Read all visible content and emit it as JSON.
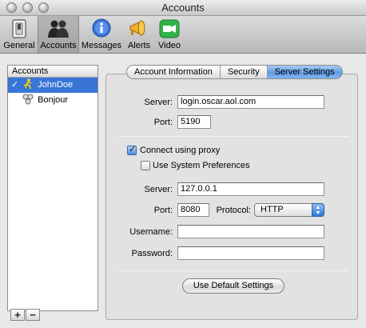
{
  "window": {
    "title": "Accounts"
  },
  "toolbar": {
    "items": [
      {
        "label": "General",
        "icon": "switch-icon"
      },
      {
        "label": "Accounts",
        "icon": "people-icon"
      },
      {
        "label": "Messages",
        "icon": "info-bubble-icon"
      },
      {
        "label": "Alerts",
        "icon": "megaphone-icon"
      },
      {
        "label": "Video",
        "icon": "camera-icon"
      }
    ],
    "selected": "Accounts"
  },
  "accounts": {
    "header": "Accounts",
    "items": [
      {
        "check": "✓",
        "name": "JohnDoe",
        "icon": "aim-running-man-icon",
        "selected": true
      },
      {
        "check": "",
        "name": "Bonjour",
        "icon": "bonjour-icon",
        "selected": false
      }
    ],
    "add_label": "+",
    "remove_label": "−"
  },
  "tabs": [
    {
      "label": "Account Information",
      "active": false
    },
    {
      "label": "Security",
      "active": false
    },
    {
      "label": "Server Settings",
      "active": true
    }
  ],
  "server_settings": {
    "server_label": "Server:",
    "server_value": "login.oscar.aol.com",
    "port_label": "Port:",
    "port_value": "5190",
    "connect_proxy_label": "Connect using proxy",
    "connect_proxy_checked": true,
    "use_system_prefs_label": "Use System Preferences",
    "use_system_prefs_checked": false,
    "proxy_server_label": "Server:",
    "proxy_server_value": "127.0.0.1",
    "proxy_port_label": "Port:",
    "proxy_port_value": "8080",
    "protocol_label": "Protocol:",
    "protocol_value": "HTTP",
    "username_label": "Username:",
    "username_value": "",
    "password_label": "Password:",
    "password_value": "",
    "default_button_label": "Use Default Settings"
  },
  "colors": {
    "selection": "#3875d7",
    "accent": "#5e9be6"
  }
}
